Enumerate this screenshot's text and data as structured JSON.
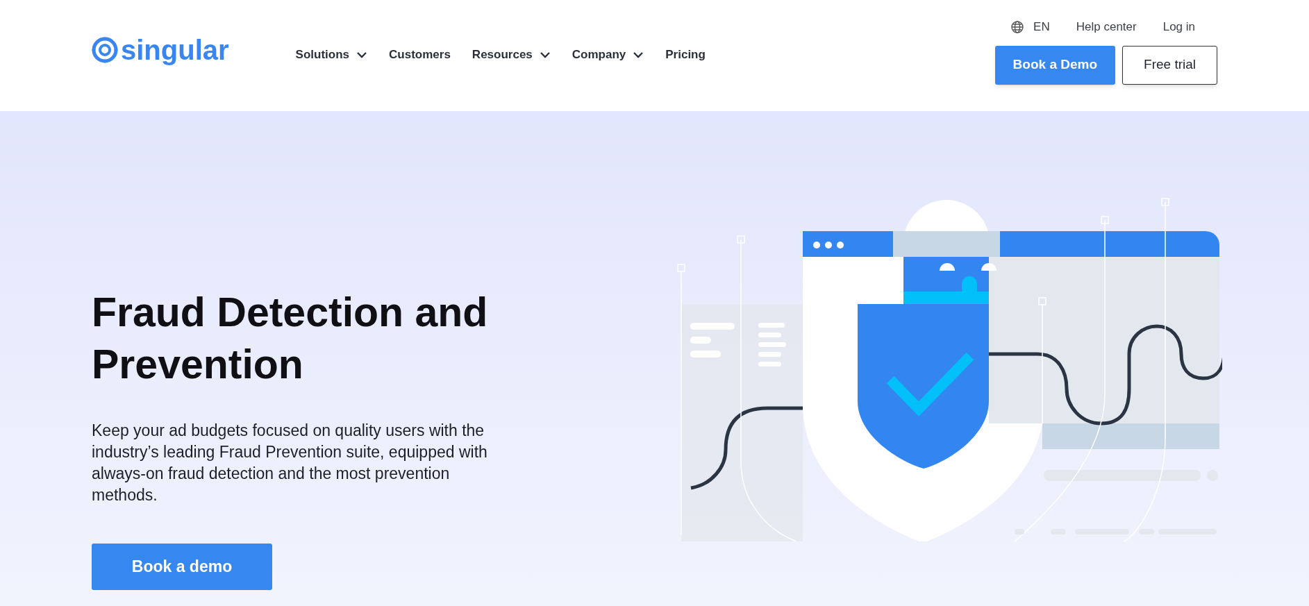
{
  "header": {
    "logo": "singular",
    "nav": [
      {
        "label": "Solutions",
        "dropdown": true
      },
      {
        "label": "Customers",
        "dropdown": false
      },
      {
        "label": "Resources",
        "dropdown": true
      },
      {
        "label": "Company",
        "dropdown": true
      },
      {
        "label": "Pricing",
        "dropdown": false
      }
    ],
    "language": "EN",
    "help": "Help center",
    "login": "Log in",
    "primary_button": "Book a Demo",
    "secondary_button": "Free trial"
  },
  "hero": {
    "title": "Fraud Detection and Prevention",
    "text": "Keep your ad budgets focused on quality users with the industry’s leading Fraud Prevention suite, equipped with always-on fraud detection and the most prevention methods.",
    "button": "Book a demo"
  }
}
